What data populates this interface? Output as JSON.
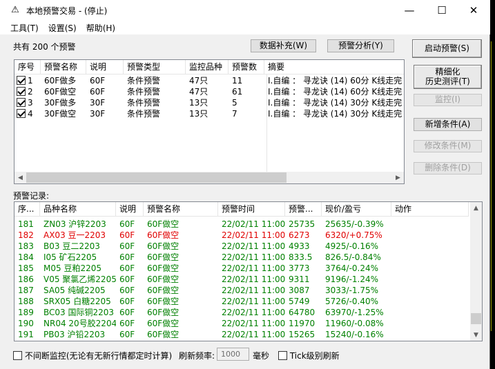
{
  "window": {
    "title": "本地预警交易 - (停止)",
    "minimize": "—",
    "maximize": "☐",
    "close": "✕"
  },
  "menu": [
    {
      "label": "工具(T)"
    },
    {
      "label": "设置(S)"
    },
    {
      "label": "帮助(H)"
    }
  ],
  "summary": "共有 200 个预警",
  "buttons": {
    "data_supplement": "数据补充(W)",
    "warn_analysis": "预警分析(Y)",
    "start_warn": "启动预警(S)",
    "refine_line1": "精细化",
    "refine_line2": "历史测评(T)",
    "monitor": "监控(I)",
    "add_condition": "新增条件(A)",
    "modify_condition": "修改条件(M)",
    "delete_condition": "删除条件(D)"
  },
  "warn_table": {
    "headers": [
      "序号",
      "预警名称",
      "说明",
      "预警类型",
      "监控品种",
      "预警数",
      "摘要"
    ],
    "rows": [
      {
        "no": "1",
        "name": "60F做多",
        "desc": "60F",
        "type": "条件预警",
        "variety": "47只",
        "count": "11",
        "summary": "I.自编 ： 寻龙诀 (14) 60分 K线走完"
      },
      {
        "no": "2",
        "name": "60F做空",
        "desc": "60F",
        "type": "条件预警",
        "variety": "47只",
        "count": "61",
        "summary": "I.自编 ： 寻龙诀 (14) 60分 K线走完"
      },
      {
        "no": "3",
        "name": "30F做多",
        "desc": "30F",
        "type": "条件预警",
        "variety": "13只",
        "count": "5",
        "summary": "I.自编 ： 寻龙诀 (14) 30分 K线走完"
      },
      {
        "no": "4",
        "name": "30F做空",
        "desc": "30F",
        "type": "条件预警",
        "variety": "13只",
        "count": "7",
        "summary": "I.自编 ： 寻龙诀 (14) 30分 K线走完"
      }
    ]
  },
  "records_label": "预警记录:",
  "records_table": {
    "headers": [
      "序...",
      "品种名称",
      "说明",
      "预警名称",
      "预警时间",
      "预警...",
      "现价/盈亏",
      "动作"
    ],
    "rows": [
      {
        "no": "181",
        "variety": "ZN03 沪锌2203",
        "desc": "60F",
        "name": "60F做空",
        "time": "22/02/11 11:00",
        "price": "25735",
        "pl": "25635/-0.39%",
        "color": "green"
      },
      {
        "no": "182",
        "variety": "AX03 豆一2203",
        "desc": "60F",
        "name": "60F做空",
        "time": "22/02/11 11:00",
        "price": "6273",
        "pl": "6320/+0.75%",
        "color": "red"
      },
      {
        "no": "183",
        "variety": "B03 豆二2203",
        "desc": "60F",
        "name": "60F做空",
        "time": "22/02/11 11:00",
        "price": "4933",
        "pl": "4925/-0.16%",
        "color": "green"
      },
      {
        "no": "184",
        "variety": "I05 矿石2205",
        "desc": "60F",
        "name": "60F做空",
        "time": "22/02/11 11:00",
        "price": "833.5",
        "pl": "826.5/-0.84%",
        "color": "green"
      },
      {
        "no": "185",
        "variety": "M05 豆粕2205",
        "desc": "60F",
        "name": "60F做空",
        "time": "22/02/11 11:00",
        "price": "3773",
        "pl": "3764/-0.24%",
        "color": "green"
      },
      {
        "no": "186",
        "variety": "V05 聚氯乙烯2205",
        "desc": "60F",
        "name": "60F做空",
        "time": "22/02/11 11:00",
        "price": "9311",
        "pl": "9196/-1.24%",
        "color": "green"
      },
      {
        "no": "187",
        "variety": "SA05 纯碱2205",
        "desc": "60F",
        "name": "60F做空",
        "time": "22/02/11 11:00",
        "price": "3087",
        "pl": "3033/-1.75%",
        "color": "green"
      },
      {
        "no": "188",
        "variety": "SRX05 白糖2205",
        "desc": "60F",
        "name": "60F做空",
        "time": "22/02/11 11:00",
        "price": "5749",
        "pl": "5726/-0.40%",
        "color": "green"
      },
      {
        "no": "189",
        "variety": "BC03 国际铜2203",
        "desc": "60F",
        "name": "60F做空",
        "time": "22/02/11 11:00",
        "price": "64780",
        "pl": "63970/-1.25%",
        "color": "green"
      },
      {
        "no": "190",
        "variety": "NR04 20号胶2204",
        "desc": "60F",
        "name": "60F做空",
        "time": "22/02/11 11:00",
        "price": "11970",
        "pl": "11960/-0.08%",
        "color": "green"
      },
      {
        "no": "191",
        "variety": "PB03 沪铅2203",
        "desc": "60F",
        "name": "60F做空",
        "time": "22/02/11 11:00",
        "price": "15265",
        "pl": "15240/-0.16%",
        "color": "green"
      }
    ]
  },
  "footer": {
    "continuous_monitor": "不间断监控(无论有无新行情都定时计算)",
    "refresh_label": "刷新频率:",
    "refresh_value": "1000",
    "unit": "毫秒",
    "tick_refresh": "Tick级别刷新"
  },
  "colors": {
    "gain": "#e00000",
    "loss": "#008000"
  }
}
